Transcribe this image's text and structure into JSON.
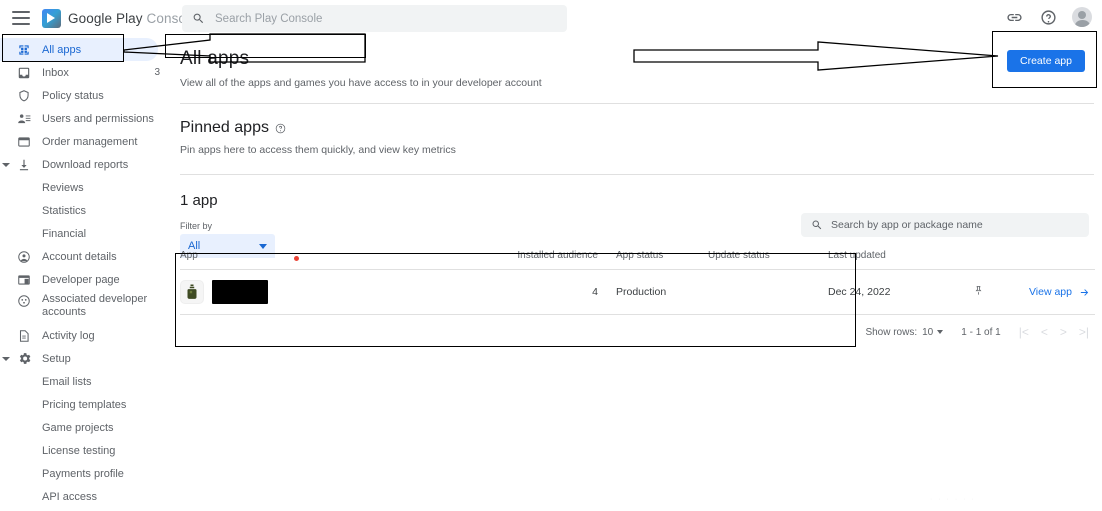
{
  "topbar": {
    "menu_icon": "hamburger-menu-icon",
    "brand_google": "Google Play ",
    "brand_console": "Console",
    "search_placeholder": "Search Play Console",
    "search_icon": "search-icon",
    "link_icon": "link-icon",
    "help_icon": "help-circle-icon",
    "avatar": "account-avatar"
  },
  "sidebar": {
    "items": [
      {
        "label": "All apps",
        "icon": "grid-apps-icon",
        "active": true,
        "badge": "",
        "caret": false,
        "sub": false
      },
      {
        "label": "Inbox",
        "icon": "inbox-icon",
        "active": false,
        "badge": "3",
        "caret": false,
        "sub": false
      },
      {
        "label": "Policy status",
        "icon": "shield-icon",
        "active": false,
        "badge": "",
        "caret": false,
        "sub": false
      },
      {
        "label": "Users and permissions",
        "icon": "person-add-icon",
        "active": false,
        "badge": "",
        "caret": false,
        "sub": false
      },
      {
        "label": "Order management",
        "icon": "order-card-icon",
        "active": false,
        "badge": "",
        "caret": false,
        "sub": false
      },
      {
        "label": "Download reports",
        "icon": "download-icon",
        "active": false,
        "badge": "",
        "caret": true,
        "sub": false
      },
      {
        "label": "Reviews",
        "icon": "",
        "active": false,
        "badge": "",
        "caret": false,
        "sub": true
      },
      {
        "label": "Statistics",
        "icon": "",
        "active": false,
        "badge": "",
        "caret": false,
        "sub": true
      },
      {
        "label": "Financial",
        "icon": "",
        "active": false,
        "badge": "",
        "caret": false,
        "sub": true
      },
      {
        "label": "Account details",
        "icon": "account-circle-icon",
        "active": false,
        "badge": "",
        "caret": false,
        "sub": false
      },
      {
        "label": "Developer page",
        "icon": "developer-page-icon",
        "active": false,
        "badge": "",
        "caret": false,
        "sub": false
      },
      {
        "label": "Associated developer accounts",
        "icon": "associated-accounts-icon",
        "active": false,
        "badge": "",
        "caret": false,
        "sub": false,
        "twoline": true
      },
      {
        "label": "Activity log",
        "icon": "document-icon",
        "active": false,
        "badge": "",
        "caret": false,
        "sub": false
      },
      {
        "label": "Setup",
        "icon": "gear-icon",
        "active": false,
        "badge": "",
        "caret": true,
        "sub": false
      },
      {
        "label": "Email lists",
        "icon": "",
        "active": false,
        "badge": "",
        "caret": false,
        "sub": true
      },
      {
        "label": "Pricing templates",
        "icon": "",
        "active": false,
        "badge": "",
        "caret": false,
        "sub": true
      },
      {
        "label": "Game projects",
        "icon": "",
        "active": false,
        "badge": "",
        "caret": false,
        "sub": true
      },
      {
        "label": "License testing",
        "icon": "",
        "active": false,
        "badge": "",
        "caret": false,
        "sub": true
      },
      {
        "label": "Payments profile",
        "icon": "",
        "active": false,
        "badge": "",
        "caret": false,
        "sub": true
      },
      {
        "label": "API access",
        "icon": "",
        "active": false,
        "badge": "",
        "caret": false,
        "sub": true
      }
    ]
  },
  "main": {
    "page_title": "All apps",
    "page_subtitle": "View all of the apps and games you have access to in your developer account",
    "pinned_title": "Pinned apps",
    "pinned_help_icon": "help-circle-icon",
    "pinned_subtitle": "Pin apps here to access them quickly, and view key metrics",
    "count_title": "1 app",
    "create_app_label": "Create app",
    "create_app_color": "#1a73e8",
    "filter": {
      "label": "Filter by",
      "value": "All",
      "caret_icon": "chevron-down-icon"
    },
    "table_search": {
      "placeholder": "Search by app or package name",
      "icon": "search-icon"
    }
  },
  "table": {
    "columns": [
      "App",
      "Installed audience",
      "App status",
      "Update status",
      "Last updated"
    ],
    "rows": [
      {
        "app_name": "[redacted]",
        "app_package": "[redacted]",
        "app_icon": "app-thumbnail-icon",
        "installed_audience": "4",
        "app_status": "Production",
        "update_status": "",
        "last_updated": "Dec 24, 2022",
        "pin_icon": "pin-icon",
        "view_app_label": "View app",
        "view_app_arrow": "arrow-right-icon"
      }
    ],
    "marker_dot_color": "#ea4335",
    "pager": {
      "show_rows_label": "Show rows:",
      "show_rows_value": "10",
      "range_label": "1 - 1 of 1",
      "first_icon": "first-page-icon",
      "prev_icon": "prev-page-icon",
      "next_icon": "next-page-icon",
      "last_icon": "last-page-icon"
    }
  },
  "annotations": {
    "left_arrow": "annotation-arrow-pointing-to-all-apps",
    "right_arrow": "annotation-arrow-pointing-to-create-app",
    "all_apps_box": "annotation-box-around-all-apps-nav",
    "title_box": "annotation-box-around-page-title",
    "create_app_box": "annotation-box-around-create-app-button",
    "table_box": "annotation-box-around-app-table"
  }
}
